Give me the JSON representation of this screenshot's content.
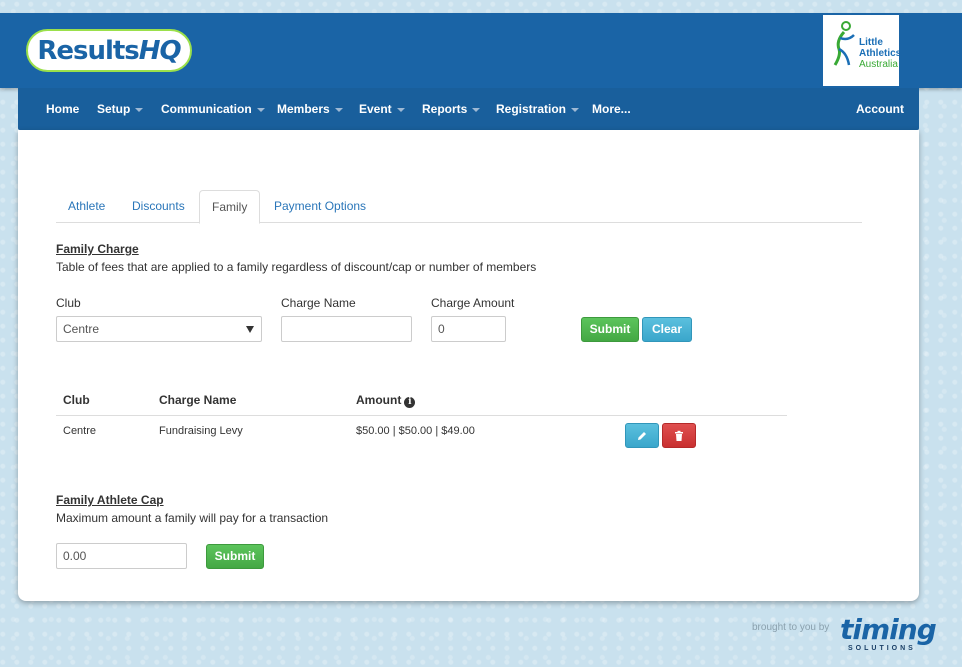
{
  "header": {
    "logo_main": "Results",
    "logo_suffix": "HQ",
    "partner_logo_line1": "Little",
    "partner_logo_line2": "Athletics",
    "partner_logo_line3": "Australia"
  },
  "nav": {
    "items": [
      {
        "label": "Home",
        "has_caret": false
      },
      {
        "label": "Setup",
        "has_caret": true
      },
      {
        "label": "Communication",
        "has_caret": true
      },
      {
        "label": "Members",
        "has_caret": true
      },
      {
        "label": "Event",
        "has_caret": true
      },
      {
        "label": "Reports",
        "has_caret": true
      },
      {
        "label": "Registration",
        "has_caret": true
      },
      {
        "label": "More...",
        "has_caret": false
      }
    ],
    "account": "Account"
  },
  "tabs": [
    {
      "label": "Athlete",
      "active": false
    },
    {
      "label": "Discounts",
      "active": false
    },
    {
      "label": "Family",
      "active": true
    },
    {
      "label": "Payment Options",
      "active": false
    }
  ],
  "family_charge": {
    "title": "Family Charge",
    "description": "Table of fees that are applied to a family regardless of discount/cap or number of members",
    "club_label": "Club",
    "club_value": "Centre",
    "charge_name_label": "Charge Name",
    "charge_name_value": "",
    "charge_amount_label": "Charge Amount",
    "charge_amount_value": "0",
    "submit_label": "Submit",
    "clear_label": "Clear",
    "table": {
      "headers": [
        "Club",
        "Charge Name",
        "Amount"
      ],
      "rows": [
        {
          "club": "Centre",
          "charge_name": "Fundraising Levy",
          "amount": "$50.00 | $50.00 | $49.00"
        }
      ]
    }
  },
  "family_cap": {
    "title": "Family Athlete Cap",
    "description": "Maximum amount a family will pay for a transaction",
    "value": "0.00",
    "submit_label": "Submit"
  },
  "footer": {
    "brought_by": "brought to you by",
    "brand": "timing",
    "brand_sub": "SOLUTIONS"
  },
  "colors": {
    "header_blue": "#1a64a6",
    "link_blue": "#2a76b9",
    "success_green": "#44a844",
    "info_blue": "#3aa6cb",
    "danger_red": "#c93030",
    "logo_green": "#9be04b"
  }
}
